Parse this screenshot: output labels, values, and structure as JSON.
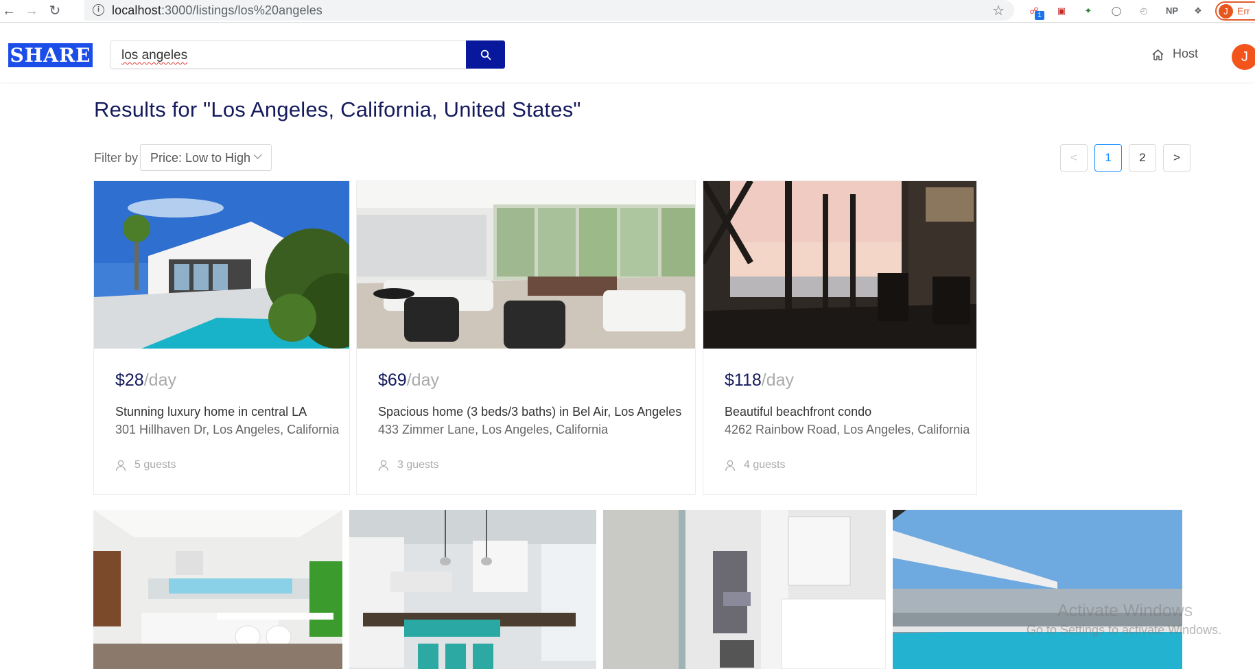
{
  "browser": {
    "url_host": "localhost",
    "url_path": ":3000/listings/los%20angeles",
    "profile_initial": "J",
    "profile_label": "Err",
    "ext_badge": "1",
    "ext_np": "NP"
  },
  "header": {
    "logo_text": "SHARE",
    "search_value": "los angeles",
    "host_label": "Host",
    "avatar_initial": "J"
  },
  "results": {
    "title": "Results for \"Los Angeles, California, United States\"",
    "filter_label": "Filter by",
    "filter_value": "Price: Low to High"
  },
  "pagination": {
    "prev": "<",
    "pages": [
      "1",
      "2"
    ],
    "current": "1",
    "next": ">"
  },
  "listings": [
    {
      "price": "$28",
      "unit": "/day",
      "title": "Stunning luxury home in central LA",
      "address": "301 Hillhaven Dr, Los Angeles, California",
      "guests": "5 guests",
      "photo": "white-modern-house-pool-icon"
    },
    {
      "price": "$69",
      "unit": "/day",
      "title": "Spacious home (3 beds/3 baths) in Bel Air, Los Angeles",
      "address": "433 Zimmer Lane, Los Angeles, California",
      "guests": "3 guests",
      "photo": "living-room-icon"
    },
    {
      "price": "$118",
      "unit": "/day",
      "title": "Beautiful beachfront condo",
      "address": "4262 Rainbow Road, Los Angeles, California",
      "guests": "4 guests",
      "photo": "ocean-sunset-room-icon"
    }
  ],
  "second_row_photos": [
    "white-kitchen-icon",
    "kitchen-island-icon",
    "bathroom-icon",
    "hillside-pool-house-icon"
  ],
  "os_watermark": {
    "line1": "Activate Windows",
    "line2": "Go to Settings to activate Windows."
  },
  "colors": {
    "brand_blue": "#1b4de8",
    "search_button": "#08189d",
    "title_navy": "#141a5c",
    "avatar_orange": "#f2541b",
    "pager_active": "#1890ff"
  }
}
